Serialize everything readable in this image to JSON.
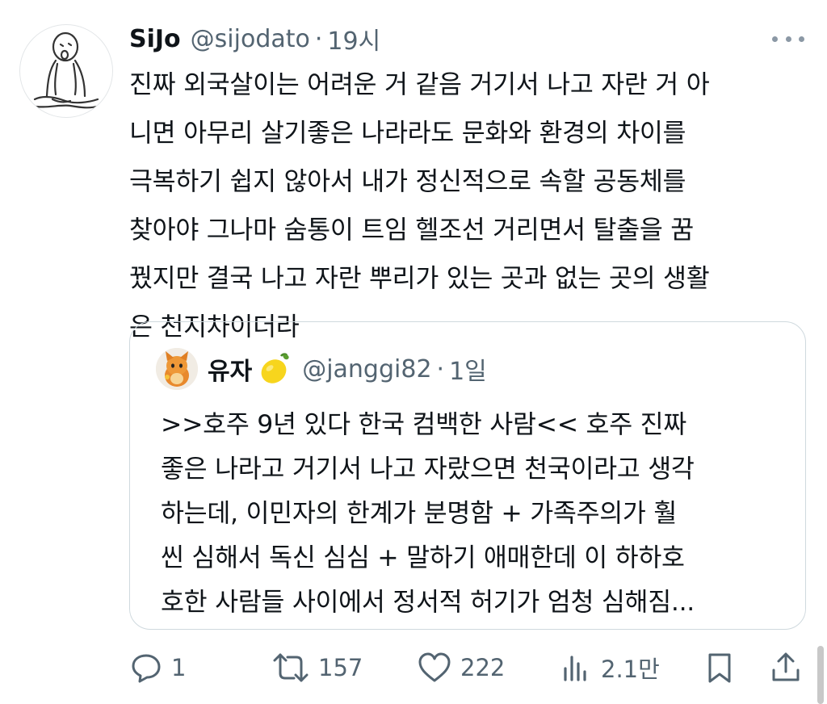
{
  "tweet": {
    "author_name": "SiJo",
    "handle": "@sijodato",
    "separator": "·",
    "time": "19시",
    "text_lines": [
      "진짜 외국살이는 어려운 거 같음 거기서 나고 자란 거 아",
      "니면 아무리 살기좋은 나라라도 문화와 환경의 차이를",
      "극복하기 쉽지 않아서 내가 정신적으로 속할 공동체를",
      "찾아야 그나마 숨통이 트임 헬조선 거리면서 탈출을 꿈",
      "꿨지만 결국 나고 자란 뿌리가 있는 곳과 없는 곳의 생활",
      "은 천지차이더라"
    ]
  },
  "quote": {
    "author_name": "유자",
    "emoji_icon": "lemon-icon",
    "handle": "@janggi82",
    "separator": "·",
    "time": "1일",
    "text_lines": [
      ">>호주 9년 있다 한국 컴백한 사람<< 호주 진짜",
      "좋은 나라고 거기서 나고 자랐으면 천국이라고 생각",
      "하는데, 이민자의 한계가 분명함 + 가족주의가 훨",
      "씬 심해서 독신 심심 + 말하기 애매한데 이 하하호",
      "호한 사람들 사이에서 정서적 허기가 엄청 심해짐..."
    ]
  },
  "actions": {
    "reply_count": "1",
    "retweet_count": "157",
    "like_count": "222",
    "views_count": "2.1만",
    "reply_icon": "reply-icon",
    "retweet_icon": "retweet-icon",
    "like_icon": "heart-icon",
    "views_icon": "views-icon",
    "bookmark_icon": "bookmark-icon",
    "share_icon": "share-icon"
  },
  "colors": {
    "text_primary": "#0f1419",
    "text_secondary": "#536471",
    "border": "#cfd9de"
  }
}
